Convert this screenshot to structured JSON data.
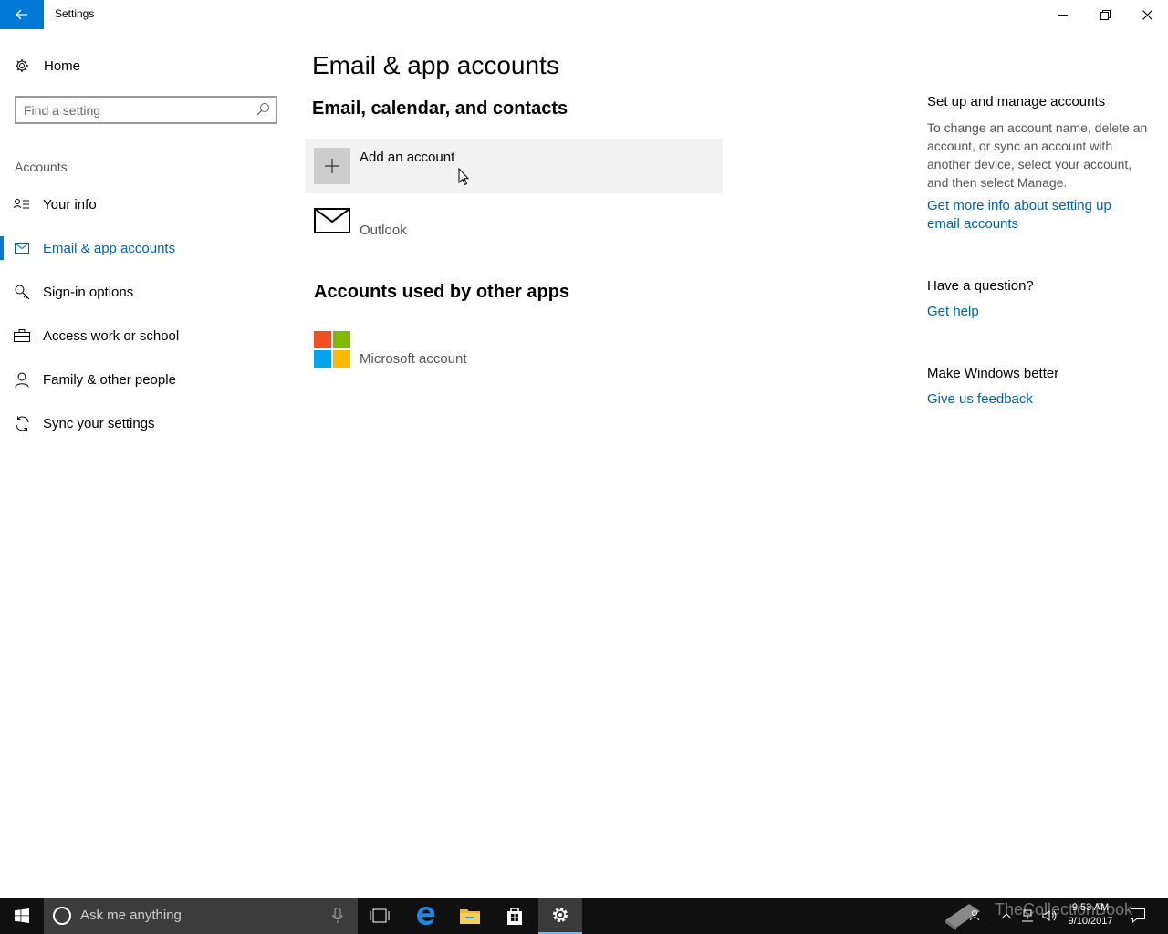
{
  "window": {
    "title": "Settings"
  },
  "sidebar": {
    "home_label": "Home",
    "search_placeholder": "Find a setting",
    "section_label": "Accounts",
    "items": [
      {
        "label": "Your info",
        "icon": "contact-card-icon"
      },
      {
        "label": "Email & app accounts",
        "icon": "mail-icon",
        "active": true
      },
      {
        "label": "Sign-in options",
        "icon": "key-icon"
      },
      {
        "label": "Access work or school",
        "icon": "briefcase-icon"
      },
      {
        "label": "Family & other people",
        "icon": "person-icon"
      },
      {
        "label": "Sync your settings",
        "icon": "sync-icon"
      }
    ]
  },
  "main": {
    "title": "Email & app accounts",
    "section1_title": "Email, calendar, and contacts",
    "add_account_label": "Add an account",
    "email_accounts": [
      {
        "label": "Outlook",
        "icon": "mail-icon"
      }
    ],
    "section2_title": "Accounts used by other apps",
    "app_accounts": [
      {
        "label": "Microsoft account",
        "icon": "microsoft-logo-icon"
      }
    ]
  },
  "right_pane": {
    "manage_heading": "Set up and manage accounts",
    "manage_text": "To change an account name, delete an account, or sync an account with another device, select your account, and then select Manage.",
    "manage_link": "Get more info about setting up email accounts",
    "question_heading": "Have a question?",
    "help_link": "Get help",
    "better_heading": "Make Windows better",
    "feedback_link": "Give us feedback"
  },
  "taskbar": {
    "search_placeholder": "Ask me anything",
    "time": "9:53 AM",
    "date": "9/10/2017",
    "watermark": "TheCollectionBook"
  },
  "colors": {
    "accent": "#0078d7",
    "link": "#0063b1",
    "ms_red": "#f25022",
    "ms_green": "#7fba00",
    "ms_blue": "#00a4ef",
    "ms_yellow": "#ffb900"
  }
}
